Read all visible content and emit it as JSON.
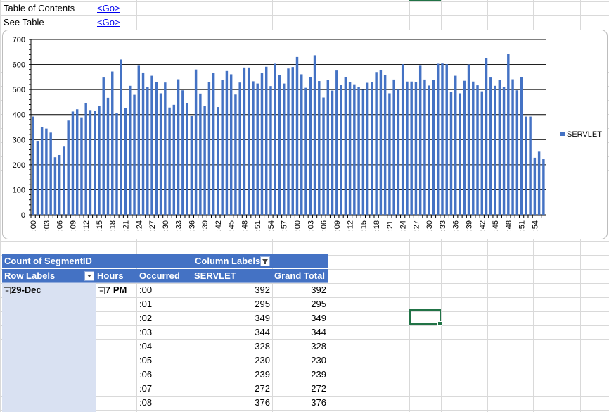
{
  "links": [
    {
      "label": "Table of Contents",
      "link": "<Go>"
    },
    {
      "label": "See Table",
      "link": "<Go>"
    }
  ],
  "chart_data": {
    "type": "bar",
    "series": [
      {
        "name": "SERVLET",
        "values": [
          392,
          295,
          349,
          344,
          328,
          230,
          239,
          272,
          376,
          412,
          421,
          389,
          447,
          418,
          416,
          434,
          548,
          467,
          572,
          405,
          620,
          427,
          515,
          479,
          595,
          568,
          510,
          555,
          531,
          485,
          528,
          428,
          439,
          541,
          497,
          447,
          395,
          580,
          484,
          433,
          529,
          567,
          430,
          537,
          574,
          561,
          480,
          528,
          588,
          588,
          533,
          524,
          565,
          591,
          514,
          603,
          557,
          524,
          584,
          590,
          630,
          561,
          507,
          549,
          637,
          534,
          468,
          538,
          496,
          576,
          520,
          551,
          529,
          521,
          509,
          499,
          527,
          530,
          570,
          579,
          557,
          485,
          540,
          500,
          601,
          532,
          532,
          529,
          595,
          540,
          516,
          539,
          603,
          604,
          601,
          490,
          555,
          485,
          535,
          600,
          532,
          517,
          493,
          625,
          548,
          515,
          537,
          511,
          641,
          541,
          497,
          551,
          392,
          392,
          228,
          252,
          222
        ]
      }
    ],
    "ylim": [
      0,
      700
    ],
    "yticks": [
      0,
      100,
      200,
      300,
      400,
      500,
      600,
      700
    ],
    "xtick_labels": [
      ":00",
      ":03",
      ":06",
      ":09",
      ":12",
      ":15",
      ":18",
      ":21",
      ":24",
      ":27",
      ":30",
      ":33",
      ":36",
      ":39",
      ":42",
      ":45",
      ":48",
      ":51",
      ":54",
      ":57",
      ":00",
      ":03",
      ":06",
      ":09",
      ":12",
      ":15",
      ":18",
      ":21",
      ":24",
      ":27",
      ":30",
      ":33",
      ":36",
      ":39",
      ":42",
      ":45",
      ":48",
      ":51",
      ":54",
      ":57"
    ],
    "grid": true,
    "legend": "right",
    "color": "#4472c4"
  },
  "pivot": {
    "title": "Count of SegmentID",
    "column_labels": "Column Labels",
    "row_labels": "Row Labels",
    "hours": "Hours",
    "occurred": "Occurred",
    "servlet": "SERVLET",
    "grand_total": "Grand Total",
    "date": "29-Dec",
    "hour": "7 PM",
    "rows": [
      {
        "occurred": ":00",
        "servlet": "392",
        "total": "392"
      },
      {
        "occurred": ":01",
        "servlet": "295",
        "total": "295"
      },
      {
        "occurred": ":02",
        "servlet": "349",
        "total": "349"
      },
      {
        "occurred": ":03",
        "servlet": "344",
        "total": "344"
      },
      {
        "occurred": ":04",
        "servlet": "328",
        "total": "328"
      },
      {
        "occurred": ":05",
        "servlet": "230",
        "total": "230"
      },
      {
        "occurred": ":06",
        "servlet": "239",
        "total": "239"
      },
      {
        "occurred": ":07",
        "servlet": "272",
        "total": "272"
      },
      {
        "occurred": ":08",
        "servlet": "376",
        "total": "376"
      }
    ]
  },
  "colors": {
    "accent": "#4472c4",
    "row_fill": "#d9e1f2",
    "selection": "#217346"
  }
}
